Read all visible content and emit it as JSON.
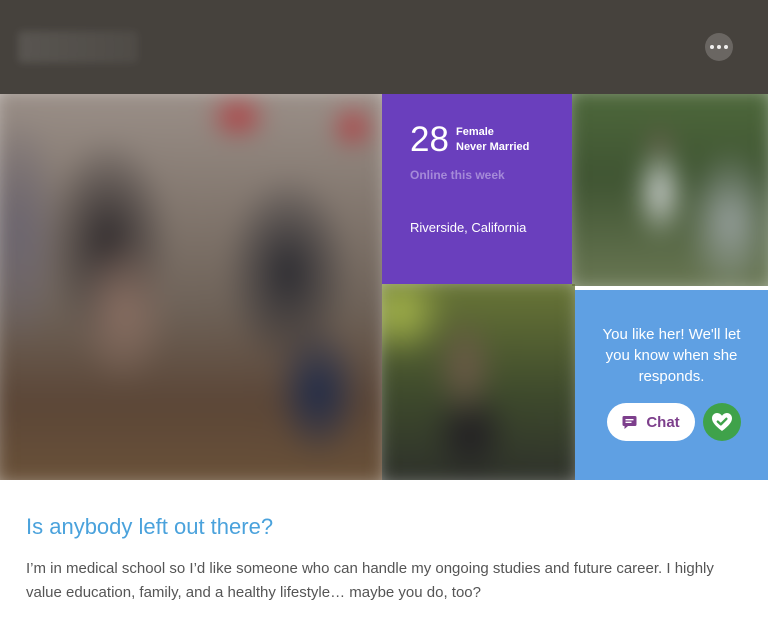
{
  "header": {
    "menu_icon": "more-horizontal-icon"
  },
  "profile": {
    "age": "28",
    "gender": "Female",
    "marital_status": "Never Married",
    "online_status": "Online this week",
    "location": "Riverside, California"
  },
  "like_panel": {
    "message": "You like her! We'll let you know when she responds.",
    "chat_label": "Chat",
    "chat_icon": "chat-bubble-icon",
    "heart_icon": "heart-check-icon"
  },
  "colors": {
    "header_bg": "#46423d",
    "stats_card": "#6a3fbd",
    "like_card": "#5fa0e3",
    "chat_text": "#7d3f8c",
    "heart_button": "#3fa24a",
    "headline": "#4aa2dc"
  },
  "about": {
    "headline": "Is anybody left out there?",
    "bio": "I’m in medical school so I’d like someone who can handle my ongoing studies and future career. I highly value education, family, and a healthy lifestyle… maybe you do, too?"
  }
}
